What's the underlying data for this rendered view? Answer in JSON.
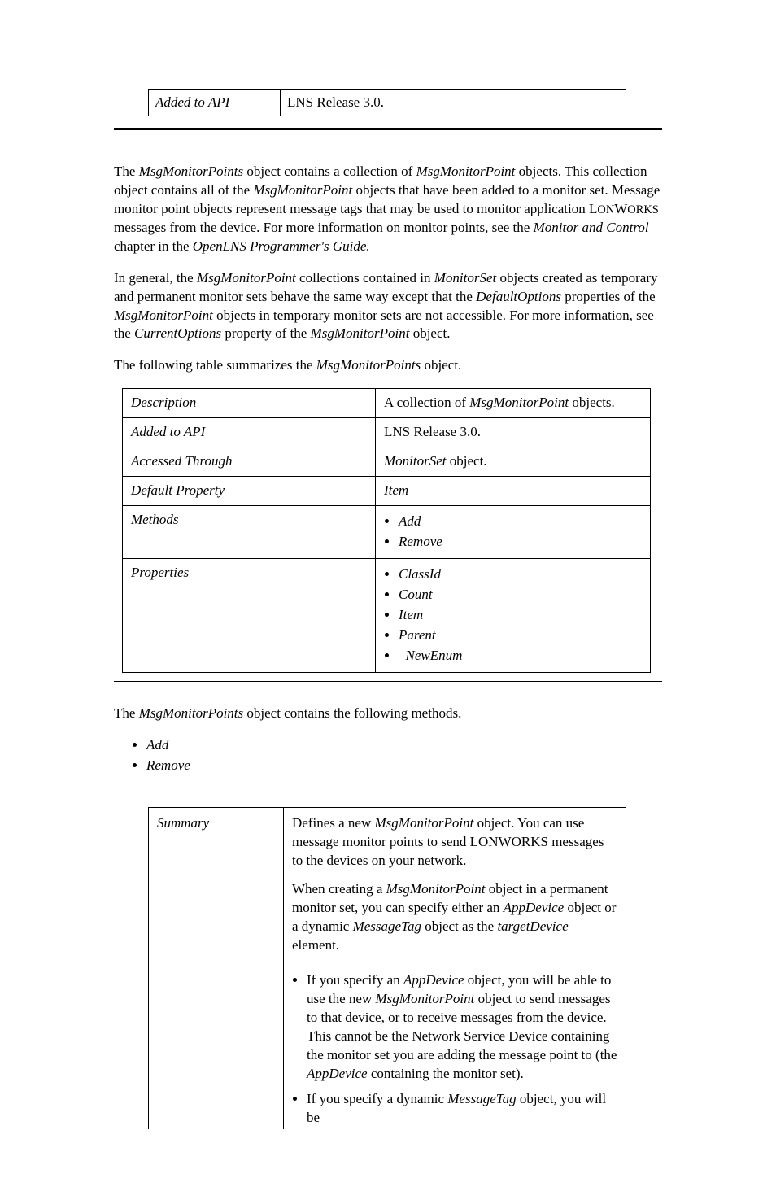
{
  "topTable": {
    "label": "Added to API",
    "value": "LNS Release 3.0."
  },
  "para1": {
    "t1": "The ",
    "i1": "MsgMonitorPoints",
    "t2": " object contains a collection of ",
    "i2": "MsgMonitorPoint",
    "t3": " objects.  This collection object contains all of the ",
    "i3": "MsgMonitorPoint",
    "t4": " objects that have been added to a monitor set.  Message monitor point objects represent message tags that may be used to monitor application L",
    "sc1": "ON",
    "t4b": "W",
    "sc2": "ORKS",
    "t5": " messages from the device. For more information on monitor points, see the ",
    "i4": "Monitor and Control",
    "t6": " chapter in the ",
    "i5": "OpenLNS Programmer's Guide.",
    "t7": ""
  },
  "para2": {
    "t1": "In general, the ",
    "i1": "MsgMonitorPoint",
    "t2": " collections contained in ",
    "i2": "MonitorSet",
    "t3": " objects created as temporary and permanent monitor sets behave the same way except that the ",
    "i3": "DefaultOptions",
    "t4": " properties of the ",
    "i4": "MsgMonitorPoint",
    "t5": " objects in temporary monitor sets are not accessible.  For more information, see the ",
    "i5": "CurrentOptions",
    "t6": " property of the ",
    "i6": "MsgMonitorPoint",
    "t7": " object."
  },
  "para3": {
    "t1": "The following table summarizes the ",
    "i1": "MsgMonitorPoints",
    "t2": " object."
  },
  "summaryTable": {
    "r1": {
      "k": "Description",
      "pre": "A collection of ",
      "i": "MsgMonitorPoint",
      "post": " objects."
    },
    "r2": {
      "k": "Added to API",
      "v": "LNS Release 3.0."
    },
    "r3": {
      "k": "Accessed Through",
      "i": "MonitorSet",
      "post": "  object."
    },
    "r4": {
      "k": "Default Property",
      "i": "Item"
    },
    "r5": {
      "k": "Methods",
      "items": [
        "Add",
        "Remove"
      ]
    },
    "r6": {
      "k": "Properties",
      "items": [
        "ClassId",
        "Count",
        "Item",
        "Parent",
        "_NewEnum"
      ]
    }
  },
  "para4": {
    "t1": "The ",
    "i1": "MsgMonitorPoints",
    "t2": " object contains the following methods."
  },
  "methodsList": [
    "Add",
    "Remove"
  ],
  "addTable": {
    "summaryLabel": "Summary",
    "p1": {
      "t1": "Defines a new ",
      "i1": "MsgMonitorPoint",
      "t2": " object.  You can use message monitor points to send LONWORKS messages to the devices on your network."
    },
    "p2": {
      "t1": "When creating a ",
      "i1": "MsgMonitorPoint",
      "t2": " object in a permanent monitor set, you can specify either an ",
      "i2": "AppDevice",
      "t3": "  object or a dynamic ",
      "i3": "MessageTag",
      "t4": " object as the ",
      "i4": "targetDevice",
      "t5": " element."
    },
    "b1": {
      "t1": "If you specify an ",
      "i1": "AppDevice",
      "t2": "  object, you will be able to use the new ",
      "i2": "MsgMonitorPoint",
      "t3": " object to send messages to that device, or to receive messages from the device. This cannot be the Network Service Device containing the monitor set you are adding the message point to (the ",
      "i3": "AppDevice",
      "t4": "    containing the monitor set)."
    },
    "b2": {
      "t1": "If you specify a dynamic ",
      "i1": "MessageTag",
      "t2": " object, you will be"
    }
  }
}
